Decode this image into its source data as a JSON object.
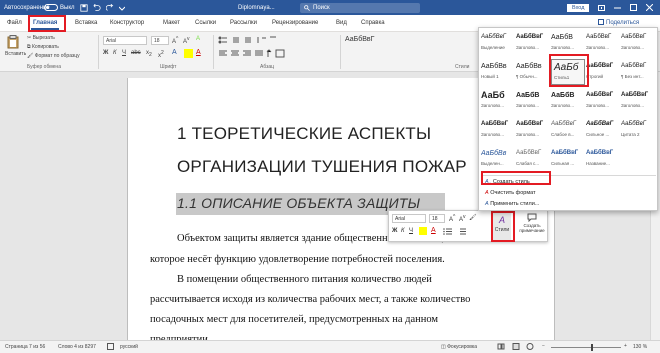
{
  "titlebar": {
    "autosave_label": "Автосохранение",
    "autosave_state": "Выкл",
    "doc_title": "Diplomnaya...",
    "search_placeholder": "Поиск",
    "signin_label": "Вход"
  },
  "tabs": [
    "Файл",
    "Главная",
    "Вставка",
    "Конструктор",
    "Макет",
    "Ссылки",
    "Рассылки",
    "Рецензирование",
    "Вид",
    "Справка"
  ],
  "share_label": "Поделиться",
  "ribbon": {
    "clipboard": {
      "paste_label": "Вставить",
      "cut_label": "Вырезать",
      "copy_label": "Копировать",
      "format_painter_label": "Формат по образцу",
      "group_label": "Буфер обмена"
    },
    "font": {
      "name": "Arial",
      "size": "18",
      "group_label": "Шрифт"
    },
    "paragraph_group_label": "Абзац",
    "styles_group_label": "Стили"
  },
  "document": {
    "heading1_line1": "1 ТЕОРЕТИЧЕСКИЕ АСПЕКТЫ",
    "heading1_line2": "ОРГАНИЗАЦИИ ТУШЕНИЯ ПОЖАР",
    "heading2": "1.1 ОПИСАНИЕ ОБЪЕКТА ЗАЩИТЫ",
    "para": [
      "Объектом   защиты   является   здание   общественного   питания,",
      "которое несёт функцию удовлетворение потребностей поселения.",
      "В   помещении   общественного   питания   количество   людей",
      "рассчитывается исходя из количества рабочих мест, а также количество",
      "посадочных   мест   для   посетителей,   предусмотренных   на   данном",
      "предприятии"
    ]
  },
  "mini_toolbar": {
    "font": "Arial",
    "size": "18",
    "styles_label": "Стили",
    "comment_label_1": "Создать",
    "comment_label_2": "примечание"
  },
  "styles_gallery": {
    "rows": [
      [
        {
          "sample": "АаБбВвГ",
          "name": "Выделение"
        },
        {
          "sample": "АаБбВвГ",
          "name": "Заголово..."
        },
        {
          "sample": "АаБбВ",
          "name": "Заголово..."
        },
        {
          "sample": "АаБбВвГ",
          "name": "Заголово..."
        },
        {
          "sample": "АаБбВвГ",
          "name": "Заголово..."
        }
      ],
      [
        {
          "sample": "АаБбВв",
          "name": "Новый 1"
        },
        {
          "sample": "АаБбВв",
          "name": "¶ Обычн..."
        },
        {
          "sample": "АаБб",
          "name": "Стиль1"
        },
        {
          "sample": "АаБбВвГ",
          "name": "Строгий"
        },
        {
          "sample": "АаБбВвГ",
          "name": "¶ Без инт..."
        }
      ],
      [
        {
          "sample": "АаБб",
          "name": "Заголово..."
        },
        {
          "sample": "АаБбВ",
          "name": "Заголово..."
        },
        {
          "sample": "АаБбВ",
          "name": "Заголово..."
        },
        {
          "sample": "АаБбВвГ",
          "name": "Заголово..."
        },
        {
          "sample": "АаБбВвГ",
          "name": "Заголово..."
        }
      ],
      [
        {
          "sample": "АаБбВвГ",
          "name": "Заголово..."
        },
        {
          "sample": "АаБбВвГ",
          "name": "Заголово..."
        },
        {
          "sample": "АаБбВвГ",
          "name": "Слабое в..."
        },
        {
          "sample": "АаБбВвГ",
          "name": "Сильное ..."
        },
        {
          "sample": "АаБбВвГ",
          "name": "Цитата 2"
        }
      ],
      [
        {
          "sample": "АаБбВв",
          "name": "Выделен..."
        },
        {
          "sample": "АаБбВвГ",
          "name": "Слабая с..."
        },
        {
          "sample": "АаБбВвГ",
          "name": "Сильная ..."
        },
        {
          "sample": "АаБбВвГ",
          "name": "Название..."
        },
        {
          "sample": "",
          "name": ""
        }
      ]
    ],
    "menu": {
      "create_style": "Создать стиль",
      "clear_format": "Очистить формат",
      "apply_styles": "Применить стили..."
    }
  },
  "statusbar": {
    "page": "Страница 7 из 56",
    "words": "Слово 4 из 8297",
    "language": "русский",
    "focus": "Фокусировка",
    "zoom": "130 %"
  },
  "colors": {
    "word_blue": "#2b579a",
    "highlight_red": "#e31b23",
    "selection_gray": "#c8c8c8"
  }
}
